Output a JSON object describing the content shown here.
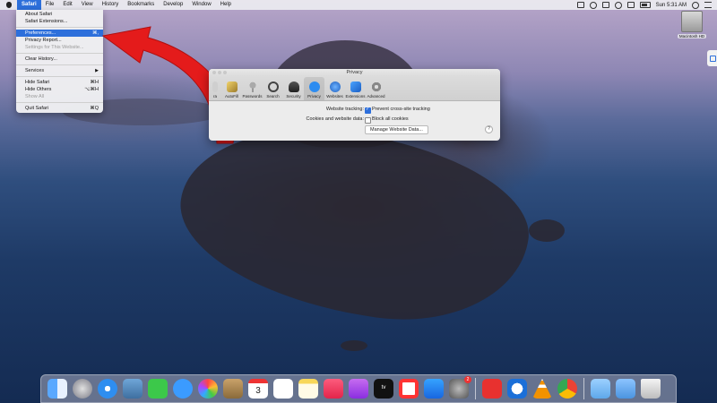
{
  "menubar": {
    "app_name": "Safari",
    "items": [
      "File",
      "Edit",
      "View",
      "History",
      "Bookmarks",
      "Develop",
      "Window",
      "Help"
    ],
    "clock": "Sun 5:31 AM"
  },
  "safari_menu": {
    "items": [
      {
        "label": "About Safari",
        "shortcut": ""
      },
      {
        "label": "Safari Extensions...",
        "shortcut": ""
      },
      {
        "label": "Preferences...",
        "shortcut": "⌘,"
      },
      {
        "label": "Privacy Report...",
        "shortcut": ""
      },
      {
        "label": "Settings for This Website...",
        "shortcut": ""
      },
      {
        "label": "Clear History...",
        "shortcut": ""
      },
      {
        "label": "Services",
        "shortcut": "▶"
      },
      {
        "label": "Hide Safari",
        "shortcut": "⌘H"
      },
      {
        "label": "Hide Others",
        "shortcut": "⌥⌘H"
      },
      {
        "label": "Show All",
        "shortcut": ""
      },
      {
        "label": "Quit Safari",
        "shortcut": "⌘Q"
      }
    ]
  },
  "preferences": {
    "title": "Privacy",
    "tabs": [
      "AutoFill",
      "Passwords",
      "Search",
      "Security",
      "Privacy",
      "Websites",
      "Extensions",
      "Advanced"
    ],
    "partial_tab_label": "ra",
    "selected_tab": "Privacy",
    "website_tracking_label": "Website tracking:",
    "website_tracking_option": "Prevent cross-site tracking",
    "cookies_label": "Cookies and website data:",
    "cookies_option": "Block all cookies",
    "manage_button": "Manage Website Data...",
    "help": "?"
  },
  "desktop": {
    "drive_label": "Macintosh HD"
  },
  "dock": {
    "apps": [
      "Finder",
      "Launchpad",
      "Safari",
      "Preview",
      "FaceTime",
      "Messages",
      "Photos",
      "Contacts",
      "Calendar",
      "Reminders",
      "Notes",
      "Music",
      "Podcasts",
      "TV",
      "News",
      "App Store",
      "System Preferences",
      "AnyDesk",
      "TeamViewer",
      "VLC",
      "Chrome",
      "Folder",
      "Downloads",
      "Trash"
    ],
    "calendar_day": "3",
    "tv_label": "tv",
    "system_prefs_badge": "2"
  },
  "colors": {
    "accent": "#2d6fdb",
    "arrow": "#e41b1b"
  }
}
